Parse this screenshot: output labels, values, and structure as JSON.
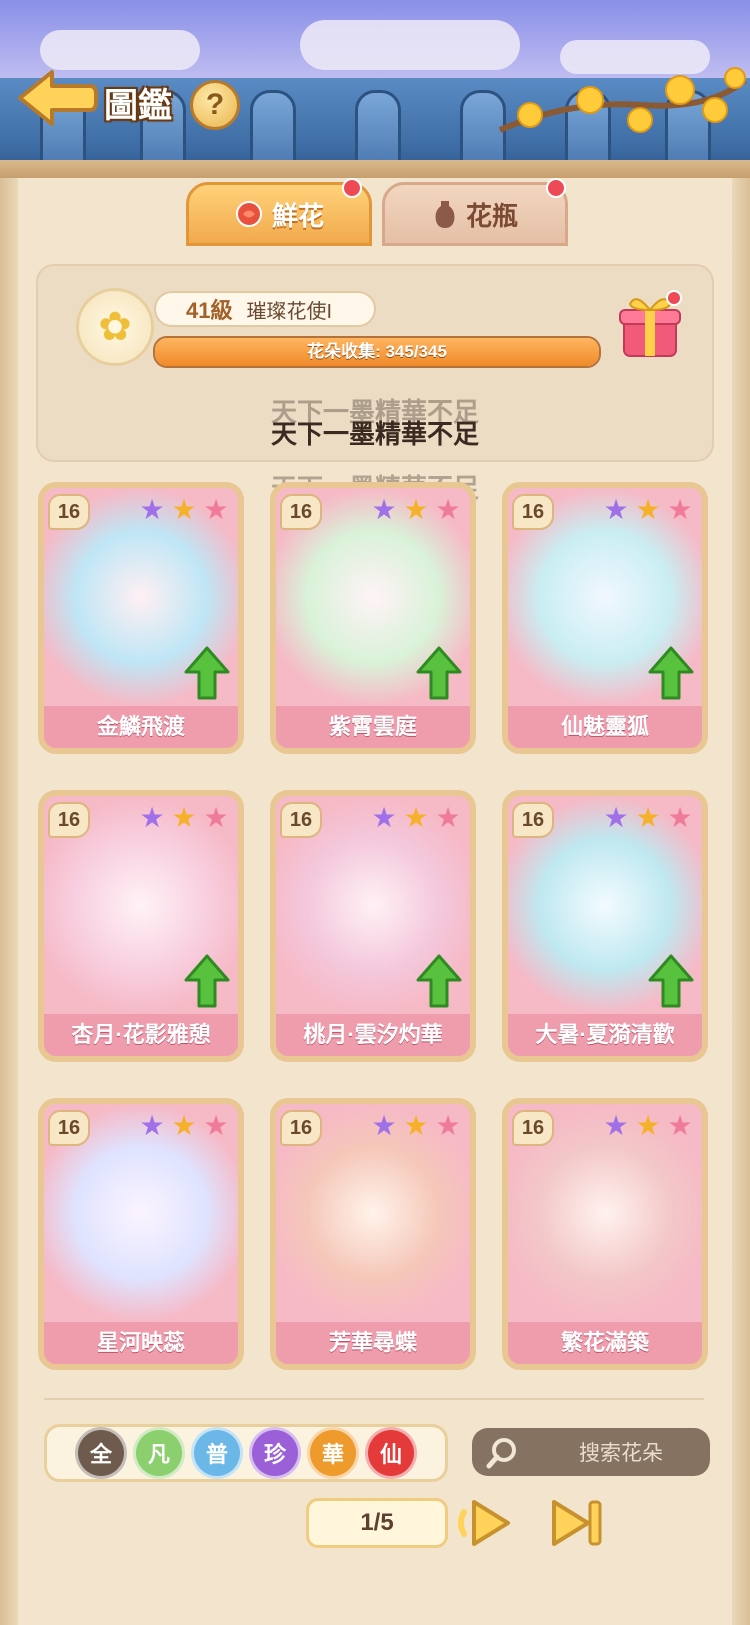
{
  "header": {
    "title": "圖鑑",
    "help_icon_label": "?"
  },
  "tabs": [
    {
      "label": "鮮花",
      "icon": "rose-icon",
      "active": true,
      "has_notification": true
    },
    {
      "label": "花瓶",
      "icon": "vase-icon",
      "active": false,
      "has_notification": true
    }
  ],
  "profile": {
    "level": "41級",
    "level_title": "璀璨花使I",
    "collection_label": "花朵收集: 345/345",
    "collection_current": 345,
    "collection_total": 345
  },
  "toast_messages": [
    "天下一墨精華不足",
    "天下一墨精華不足",
    "天下一墨精華不足"
  ],
  "cards": [
    {
      "level": "16",
      "name": "金鱗飛渡",
      "upgradable": true
    },
    {
      "level": "16",
      "name": "紫霄雲庭",
      "upgradable": true
    },
    {
      "level": "16",
      "name": "仙魅靈狐",
      "upgradable": true
    },
    {
      "level": "16",
      "name": "杏月·花影雅憩",
      "upgradable": true
    },
    {
      "level": "16",
      "name": "桃月·雲汐灼華",
      "upgradable": true
    },
    {
      "level": "16",
      "name": "大暑·夏漪清歡",
      "upgradable": true
    },
    {
      "level": "16",
      "name": "星河映蕊",
      "upgradable": false
    },
    {
      "level": "16",
      "name": "芳華尋蝶",
      "upgradable": false
    },
    {
      "level": "16",
      "name": "繁花滿築",
      "upgradable": false
    }
  ],
  "rarity_filters": [
    {
      "label": "全",
      "color": "#6f5a4e"
    },
    {
      "label": "凡",
      "color": "#8ccf6e"
    },
    {
      "label": "普",
      "color": "#6bb8e8"
    },
    {
      "label": "珍",
      "color": "#9b5fd8"
    },
    {
      "label": "華",
      "color": "#ef9a2c"
    },
    {
      "label": "仙",
      "color": "#e43a3a"
    }
  ],
  "search": {
    "placeholder": "搜索花朵"
  },
  "pagination": {
    "label": "1/5",
    "current": 1,
    "total": 5
  },
  "colors": {
    "star_purple": "#a070e8",
    "star_gold": "#f6b12a",
    "star_pink": "#f07a9a",
    "upgrade_green": "#58c23e"
  }
}
